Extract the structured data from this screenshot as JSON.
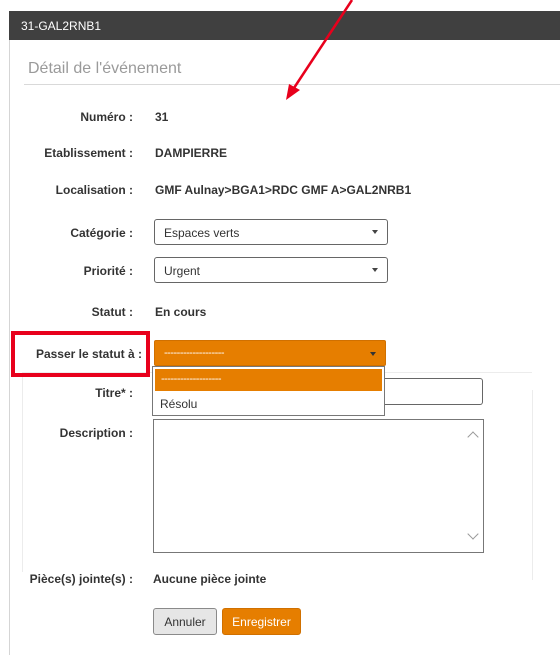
{
  "window": {
    "title": "31-GAL2RNB1"
  },
  "section": {
    "title": "Détail de l'événement"
  },
  "fields": {
    "numero": {
      "label": "Numéro :",
      "value": "31"
    },
    "etablissement": {
      "label": "Etablissement :",
      "value": "DAMPIERRE"
    },
    "localisation": {
      "label": "Localisation :",
      "value": "GMF Aulnay>BGA1>RDC GMF A>GAL2NRB1"
    },
    "categorie": {
      "label": "Catégorie :",
      "selected": "Espaces verts"
    },
    "priorite": {
      "label": "Priorité :",
      "selected": "Urgent"
    },
    "statut": {
      "label": "Statut :",
      "value": "En cours"
    },
    "passer_statut": {
      "label": "Passer le statut à :",
      "selected": "-------------------",
      "options": [
        "-------------------",
        "Résolu"
      ]
    },
    "titre": {
      "label": "Titre* :",
      "value": ""
    },
    "description": {
      "label": "Description :",
      "value": ""
    },
    "pieces_jointes": {
      "label": "Pièce(s) jointe(s) :",
      "value": "Aucune pièce jointe"
    }
  },
  "buttons": {
    "cancel": "Annuler",
    "save": "Enregistrer"
  },
  "colors": {
    "accent": "#e67e00",
    "title_bar": "#404040",
    "highlight": "#e8001c"
  }
}
